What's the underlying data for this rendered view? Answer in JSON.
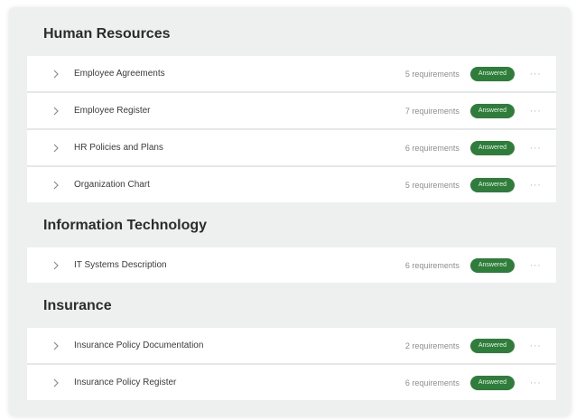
{
  "sections": [
    {
      "title": "Human Resources",
      "items": [
        {
          "label": "Employee Agreements",
          "requirements": "5 requirements",
          "status": "Answered"
        },
        {
          "label": "Employee Register",
          "requirements": "7 requirements",
          "status": "Answered"
        },
        {
          "label": "HR Policies and Plans",
          "requirements": "6 requirements",
          "status": "Answered"
        },
        {
          "label": "Organization Chart",
          "requirements": "5 requirements",
          "status": "Answered"
        }
      ]
    },
    {
      "title": "Information Technology",
      "items": [
        {
          "label": "IT Systems Description",
          "requirements": "6 requirements",
          "status": "Answered"
        }
      ]
    },
    {
      "title": "Insurance",
      "items": [
        {
          "label": "Insurance Policy Documentation",
          "requirements": "2 requirements",
          "status": "Answered"
        },
        {
          "label": "Insurance Policy Register",
          "requirements": "6 requirements",
          "status": "Answered"
        }
      ]
    }
  ],
  "icons": {
    "expand": "chevron-right-icon",
    "more": "more-horizontal-icon"
  },
  "more_glyph": "···",
  "colors": {
    "badge_bg": "#2f7d3a",
    "background": "#eef0ef",
    "row_bg": "#ffffff"
  }
}
